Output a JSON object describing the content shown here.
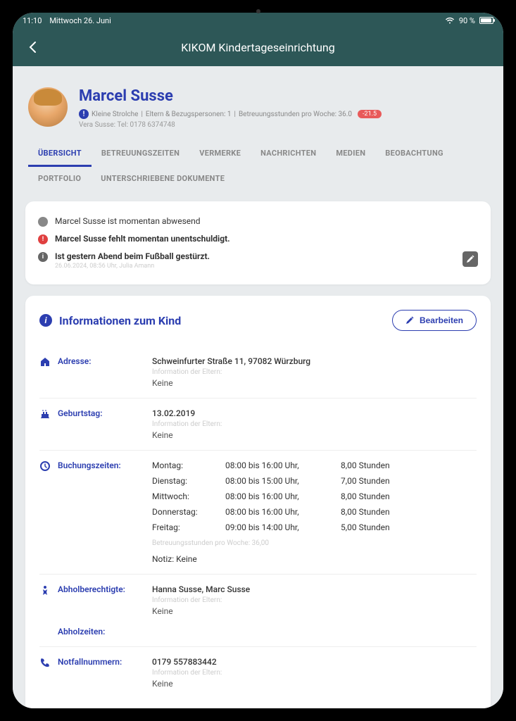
{
  "statusbar": {
    "time": "11:10",
    "date": "Mittwoch 26. Juni",
    "battery_pct": "90 %"
  },
  "header": {
    "title": "KIKOM Kindertageseinrichtung"
  },
  "profile": {
    "name": "Marcel Susse",
    "meta_group": "Kleine Strolche",
    "meta_guardians": "Eltern & Bezugspersonen: 1",
    "meta_hours": "Betreuungsstunden pro Woche: 36.0",
    "badge": "-21.5",
    "contact": "Vera Susse: Tel: 0178 6374748"
  },
  "tabs": {
    "overview": "ÜBERSICHT",
    "care": "BETREUUNGSZEITEN",
    "notes": "VERMERKE",
    "messages": "NACHRICHTEN",
    "media": "MEDIEN",
    "observation": "BEOBACHTUNG",
    "portfolio": "PORTFOLIO",
    "signed": "UNTERSCHRIEBENE DOKUMENTE"
  },
  "status": {
    "s1": "Marcel Susse ist momentan abwesend",
    "s2": "Marcel Susse fehlt momentan unentschuldigt.",
    "s3": "Ist gestern Abend beim Fußball gestürzt.",
    "s3_sub": "26.06.2024, 08:56 Uhr, Julia Amann"
  },
  "section": {
    "title": "Informationen zum Kind",
    "edit_label": "Bearbeiten"
  },
  "info": {
    "address": {
      "label": "Adresse:",
      "value": "Schweinfurter Straße 11, 97082 Würzburg",
      "hint": "Information der Eltern:",
      "none": "Keine"
    },
    "birthday": {
      "label": "Geburtstag:",
      "value": "13.02.2019",
      "hint": "Information der Eltern:",
      "none": "Keine"
    },
    "booking": {
      "label": "Buchungszeiten:",
      "rows": [
        {
          "day": "Montag:",
          "time": "08:00 bis 16:00 Uhr,",
          "hours": "8,00 Stunden"
        },
        {
          "day": "Dienstag:",
          "time": "08:00 bis 15:00 Uhr,",
          "hours": "7,00 Stunden"
        },
        {
          "day": "Mittwoch:",
          "time": "08:00 bis 16:00 Uhr,",
          "hours": "8,00 Stunden"
        },
        {
          "day": "Donnerstag:",
          "time": "08:00 bis 16:00 Uhr,",
          "hours": "8,00 Stunden"
        },
        {
          "day": "Freitag:",
          "time": "09:00 bis 14:00 Uhr,",
          "hours": "5,00 Stunden"
        }
      ],
      "total": "Betreuungsstunden pro Woche: 36,00",
      "notiz": "Notiz: Keine"
    },
    "pickup": {
      "label": "Abholberechtigte:",
      "value": "Hanna Susse, Marc Susse",
      "hint": "Information der Eltern:",
      "none": "Keine",
      "times_label": "Abholzeiten:"
    },
    "emergency": {
      "label": "Notfallnummern:",
      "value": "0179 557883442",
      "hint": "Information der Eltern:",
      "none": "Keine"
    }
  }
}
